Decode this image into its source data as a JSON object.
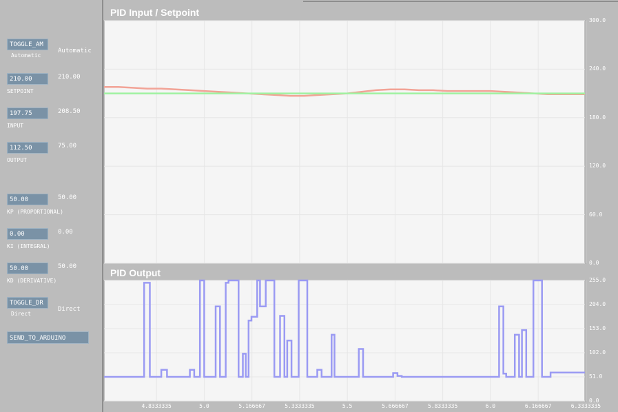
{
  "sidebar": {
    "toggle_am": {
      "label": "TOGGLE_AM",
      "state": "Automatic",
      "value": "Automatic"
    },
    "setpoint": {
      "field": "210.00",
      "label": "SETPOINT",
      "value": "210.00"
    },
    "input": {
      "field": "197.75",
      "label": "INPUT",
      "value": "208.50"
    },
    "output": {
      "field": "112.50",
      "label": "OUTPUT",
      "value": "75.00"
    },
    "kp": {
      "field": "50.00",
      "label": "KP (PROPORTIONAL)",
      "value": "50.00"
    },
    "ki": {
      "field": "0.00",
      "label": "KI (INTEGRAL)",
      "value": "0.00"
    },
    "kd": {
      "field": "50.00",
      "label": "KD (DERIVATIVE)",
      "value": "50.00"
    },
    "toggle_dr": {
      "label": "TOGGLE_DR",
      "state": "Direct",
      "value": "Direct"
    },
    "send_button": "SEND_TO_ARDUINO"
  },
  "colors": {
    "input_line": "#f2a396",
    "setpoint_line": "#9ff2a1",
    "output_line": "#9a9af3"
  },
  "chart_data": [
    {
      "type": "line",
      "title": "PID Input / Setpoint",
      "ylim": [
        0,
        300
      ],
      "y_ticks": [
        "300.0",
        "240.0",
        "180.0",
        "120.0",
        "60.0",
        "0.0"
      ],
      "x": [
        4.65,
        4.7,
        4.75,
        4.8,
        4.85,
        4.9,
        4.95,
        5.0,
        5.05,
        5.1,
        5.15,
        5.2,
        5.25,
        5.3,
        5.35,
        5.4,
        5.45,
        5.5,
        5.55,
        5.6,
        5.65,
        5.7,
        5.75,
        5.8,
        5.85,
        5.9,
        5.95,
        6.0,
        6.05,
        6.1,
        6.15,
        6.2,
        6.25,
        6.3,
        6.33
      ],
      "series": [
        {
          "name": "",
          "values": [
            218,
            218,
            217,
            216,
            216,
            215,
            214,
            213,
            212,
            211,
            210,
            209,
            208,
            207,
            207,
            208,
            209,
            210,
            212,
            214,
            215,
            215,
            214,
            214,
            213,
            213,
            213,
            213,
            212,
            211,
            210,
            209,
            209,
            209,
            209
          ]
        },
        {
          "name": "",
          "values": [
            210,
            210,
            210,
            210,
            210,
            210,
            210,
            210,
            210,
            210,
            210,
            210,
            210,
            210,
            210,
            210,
            210,
            210,
            210,
            210,
            210,
            210,
            210,
            210,
            210,
            210,
            210,
            210,
            210,
            210,
            210,
            210,
            210,
            210,
            210
          ]
        }
      ],
      "grid": true
    },
    {
      "type": "line",
      "title": "PID Output",
      "ylim": [
        0,
        255
      ],
      "y_ticks": [
        "255.0",
        "204.0",
        "153.0",
        "102.0",
        "51.0",
        "0.0"
      ],
      "x_ticks": [
        "4.8333335",
        "5.0",
        "5.166667",
        "5.3333335",
        "5.5",
        "5.666667",
        "5.8333335",
        "6.0",
        "6.166667",
        "6.3333335"
      ],
      "x_tick_values": [
        4.8333335,
        5.0,
        5.166667,
        5.3333335,
        5.5,
        5.666667,
        5.8333335,
        6.0,
        6.166667,
        6.3333335
      ],
      "series": [
        {
          "name": "",
          "points": [
            [
              4.65,
              51
            ],
            [
              4.79,
              51
            ],
            [
              4.79,
              250
            ],
            [
              4.81,
              250
            ],
            [
              4.81,
              51
            ],
            [
              4.85,
              51
            ],
            [
              4.85,
              66
            ],
            [
              4.87,
              66
            ],
            [
              4.87,
              51
            ],
            [
              4.95,
              51
            ],
            [
              4.95,
              66
            ],
            [
              4.965,
              66
            ],
            [
              4.965,
              51
            ],
            [
              4.985,
              51
            ],
            [
              4.985,
              255
            ],
            [
              5.0,
              255
            ],
            [
              5.0,
              51
            ],
            [
              5.04,
              51
            ],
            [
              5.04,
              200
            ],
            [
              5.055,
              200
            ],
            [
              5.055,
              51
            ],
            [
              5.075,
              51
            ],
            [
              5.075,
              250
            ],
            [
              5.085,
              250
            ],
            [
              5.085,
              255
            ],
            [
              5.12,
              255
            ],
            [
              5.12,
              51
            ],
            [
              5.135,
              51
            ],
            [
              5.135,
              100
            ],
            [
              5.145,
              100
            ],
            [
              5.145,
              51
            ],
            [
              5.155,
              51
            ],
            [
              5.155,
              170
            ],
            [
              5.165,
              170
            ],
            [
              5.165,
              178
            ],
            [
              5.185,
              178
            ],
            [
              5.185,
              255
            ],
            [
              5.195,
              255
            ],
            [
              5.195,
              200
            ],
            [
              5.215,
              200
            ],
            [
              5.215,
              255
            ],
            [
              5.245,
              255
            ],
            [
              5.245,
              51
            ],
            [
              5.265,
              51
            ],
            [
              5.265,
              180
            ],
            [
              5.28,
              180
            ],
            [
              5.28,
              51
            ],
            [
              5.29,
              51
            ],
            [
              5.29,
              128
            ],
            [
              5.305,
              128
            ],
            [
              5.305,
              51
            ],
            [
              5.33,
              51
            ],
            [
              5.33,
              255
            ],
            [
              5.36,
              255
            ],
            [
              5.36,
              51
            ],
            [
              5.395,
              51
            ],
            [
              5.395,
              66
            ],
            [
              5.41,
              66
            ],
            [
              5.41,
              51
            ],
            [
              5.445,
              51
            ],
            [
              5.445,
              140
            ],
            [
              5.455,
              140
            ],
            [
              5.455,
              51
            ],
            [
              5.54,
              51
            ],
            [
              5.54,
              110
            ],
            [
              5.555,
              110
            ],
            [
              5.555,
              51
            ],
            [
              5.66,
              51
            ],
            [
              5.66,
              59
            ],
            [
              5.675,
              59
            ],
            [
              5.675,
              53
            ],
            [
              5.69,
              53
            ],
            [
              5.69,
              51
            ],
            [
              6.03,
              51
            ],
            [
              6.03,
              200
            ],
            [
              6.045,
              200
            ],
            [
              6.045,
              58
            ],
            [
              6.055,
              58
            ],
            [
              6.055,
              51
            ],
            [
              6.085,
              51
            ],
            [
              6.085,
              140
            ],
            [
              6.1,
              140
            ],
            [
              6.1,
              51
            ],
            [
              6.11,
              51
            ],
            [
              6.11,
              150
            ],
            [
              6.125,
              150
            ],
            [
              6.125,
              51
            ],
            [
              6.15,
              51
            ],
            [
              6.15,
              255
            ],
            [
              6.18,
              255
            ],
            [
              6.18,
              51
            ],
            [
              6.21,
              51
            ],
            [
              6.21,
              60
            ],
            [
              6.33,
              60
            ]
          ]
        }
      ],
      "grid": true
    }
  ]
}
